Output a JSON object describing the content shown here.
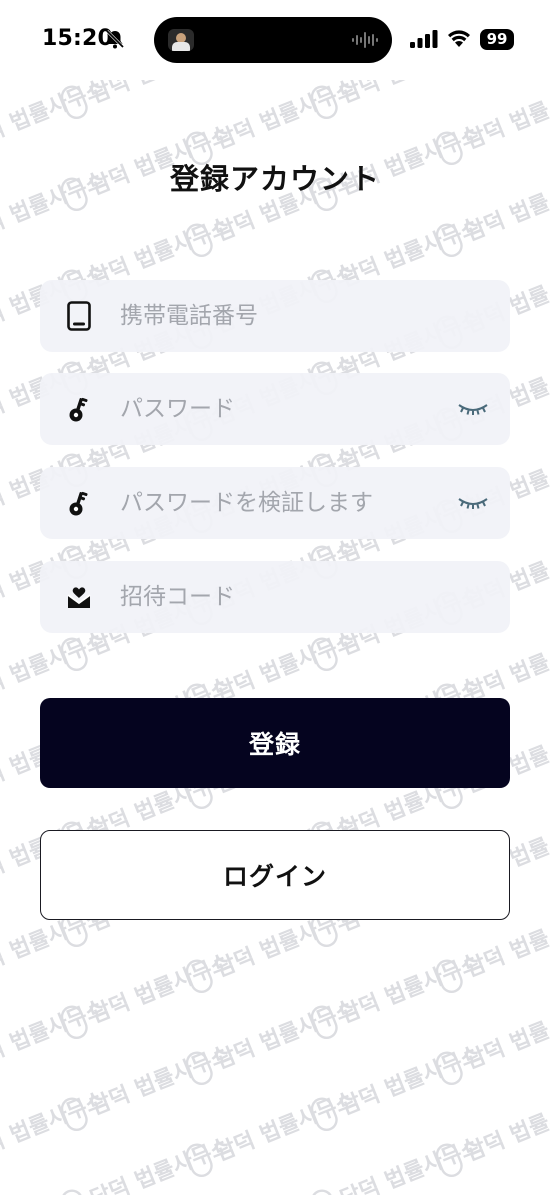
{
  "status_bar": {
    "time": "15:20",
    "battery": "99",
    "icons": [
      "bell-slash-icon",
      "cellular-signal-icon",
      "wifi-icon",
      "battery-icon"
    ]
  },
  "dynamic_island": {
    "icons": [
      "now-playing-thumbnail",
      "audio-waveform-icon"
    ]
  },
  "page": {
    "title": "登録アカウント"
  },
  "form": {
    "phone": {
      "placeholder": "携帯電話番号",
      "value": "",
      "icon": "phone-icon"
    },
    "password": {
      "placeholder": "パスワード",
      "value": "",
      "icon": "key-icon",
      "toggle_icon": "eye-closed-icon"
    },
    "confirm_password": {
      "placeholder": "パスワードを検証します",
      "value": "",
      "icon": "key-icon",
      "toggle_icon": "eye-closed-icon"
    },
    "invite_code": {
      "placeholder": "招待コード",
      "value": "",
      "icon": "mail-heart-icon"
    }
  },
  "buttons": {
    "register": "登録",
    "login": "ログイン"
  },
  "watermark": {
    "text": "담덕 법률사무소"
  },
  "colors": {
    "primary_button": "#05041f",
    "field_background": "#f1f2f7",
    "placeholder": "#a3a6ad",
    "eye_icon": "#4a6a7a"
  }
}
